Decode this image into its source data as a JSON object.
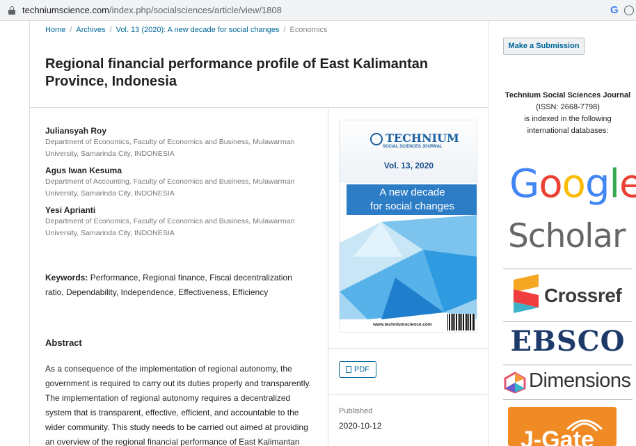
{
  "browser": {
    "url_host": "techniumscience.com",
    "url_path": "/index.php/socialsciences/article/view/1808"
  },
  "breadcrumb": {
    "home": "Home",
    "archives": "Archives",
    "issue": "Vol. 13 (2020): A new decade for social changes",
    "section": "Economics"
  },
  "article": {
    "title": "Regional financial performance profile of East Kalimantan Province, Indonesia",
    "authors": [
      {
        "name": "Juliansyah Roy",
        "affiliation": "Department of Economics, Faculty of Economics and Business, Mulawarman University, Samarinda City, INDONESIA"
      },
      {
        "name": "Agus Iwan Kesuma",
        "affiliation": "Department of Accounting, Faculty of Economics and Business, Mulawarman University, Samarinda City, INDONESIA"
      },
      {
        "name": "Yesi Aprianti",
        "affiliation": "Department of Economics, Faculty of Economics and Business, Mulawarman University, Samarinda City, INDONESIA"
      }
    ],
    "keywords_label": "Keywords:",
    "keywords": "Performance, Regional finance, Fiscal decentralization ratio, Dependability, Independence, Effectiveness, Efficiency",
    "abstract_heading": "Abstract",
    "abstract_text": "As a consequence of the implementation of regional autonomy, the government is required to carry out its duties properly and transparently. The implementation of regional autonomy requires a decentralized system that is transparent, effective, efficient, and accountable to the wider community. This study needs to be carried out aimed at providing an overview of the regional financial performance of East Kalimantan Province"
  },
  "cover": {
    "logo": "TECHNIUM",
    "logo_sub": "SOCIAL SCIENCES JOURNAL",
    "volume": "Vol. 13, 2020",
    "band_line1": "A new decade",
    "band_line2": "for social changes",
    "site": "www.techniumscience.com"
  },
  "galley": {
    "pdf_label": "PDF",
    "published_label": "Published",
    "published_date": "2020-10-12"
  },
  "sidebar": {
    "submit_label": "Make a Submission",
    "journal_name": "Technium Social Sciences Journal",
    "issn": "(ISSN: 2668-7798)",
    "indexed_text": "is indexed in the following international databases:",
    "gs_google": "Google",
    "gs_scholar": "Scholar",
    "crossref": "Crossref",
    "ebsco": "EBSCO",
    "dimensions": "Dimensions",
    "jgate": "J-Gate"
  },
  "colors": {
    "link": "#006798",
    "google_blue": "#4285f4",
    "google_red": "#ea4335",
    "google_yellow": "#fbbc05",
    "google_green": "#34a853",
    "jgate_orange": "#f08a24"
  }
}
